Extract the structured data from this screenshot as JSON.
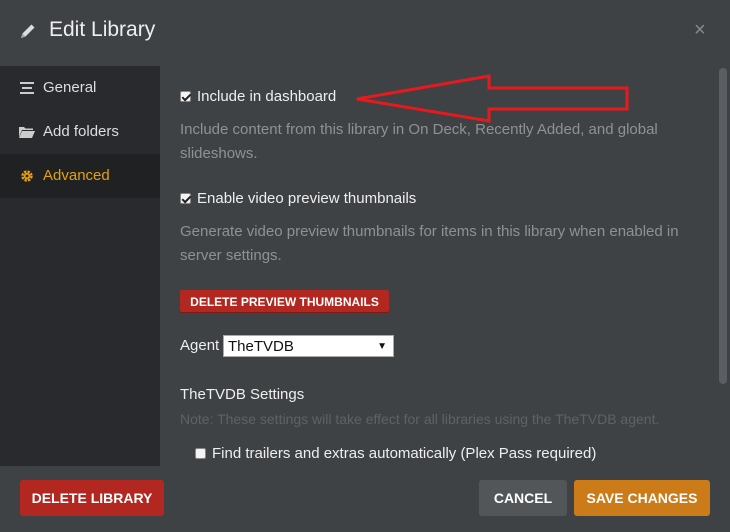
{
  "header": {
    "title": "Edit Library",
    "close_symbol": "×"
  },
  "sidebar": {
    "items": [
      {
        "label": "General",
        "icon": "list-icon"
      },
      {
        "label": "Add folders",
        "icon": "folder-icon"
      },
      {
        "label": "Advanced",
        "icon": "gear-icon",
        "active": true
      }
    ]
  },
  "advanced": {
    "include_dashboard": {
      "label": "Include in dashboard",
      "checked": true
    },
    "include_dashboard_help_1": "Include content from this library in On Deck, Recently Added, and global",
    "include_dashboard_help_2": "slideshows.",
    "video_preview": {
      "label": "Enable video preview thumbnails",
      "checked": true
    },
    "video_preview_help_1": "Generate video preview thumbnails for items in this library when enabled in",
    "video_preview_help_2": "server settings.",
    "delete_thumbnails_label": "DELETE PREVIEW THUMBNAILS",
    "agent_label": "Agent",
    "agent_value": "TheTVDB",
    "agent_settings_title": "TheTVDB Settings",
    "agent_settings_note": "Note: These settings will take effect for all libraries using the TheTVDB agent.",
    "find_trailers": {
      "label": "Find trailers and extras automatically (Plex Pass required)",
      "checked": false
    }
  },
  "footer": {
    "delete_library_label": "DELETE LIBRARY",
    "cancel_label": "CANCEL",
    "save_label": "SAVE CHANGES"
  },
  "colors": {
    "accent": "#e5a00d",
    "danger": "#b2271f",
    "save": "#cc7b19",
    "annotation_arrow": "#e8191c"
  }
}
